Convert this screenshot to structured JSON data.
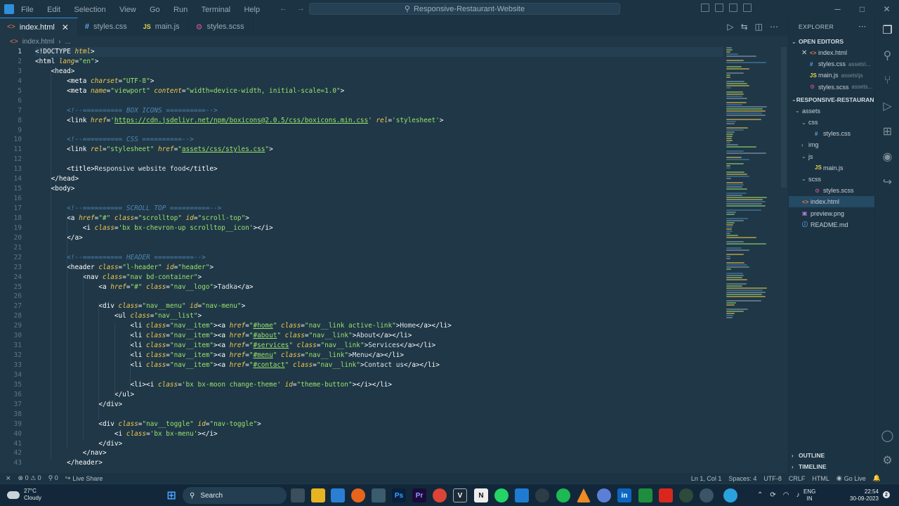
{
  "titlebar": {
    "menu": [
      "File",
      "Edit",
      "Selection",
      "View",
      "Go",
      "Run",
      "Terminal",
      "Help"
    ],
    "search": "Responsive-Restaurant-Website",
    "window_controls": [
      "─",
      "□",
      "✕"
    ]
  },
  "tabs": [
    {
      "icon": "<>",
      "label": "index.html",
      "active": true
    },
    {
      "icon": "#",
      "label": "styles.css"
    },
    {
      "icon": "JS",
      "label": "main.js"
    },
    {
      "icon": "⚙",
      "label": "styles.scss"
    }
  ],
  "breadcrumb": {
    "file": "index.html",
    "rest": "..."
  },
  "editor": {
    "line_numbers": [
      "1",
      "2",
      "3",
      "4",
      "5",
      "6",
      "7",
      "8",
      "9",
      "10",
      "11",
      "12",
      "13",
      "14",
      "15",
      "16",
      "17",
      "18",
      "19",
      "20",
      "21",
      "22",
      "23",
      "24",
      "25",
      "26",
      "27",
      "28",
      "29",
      "30",
      "31",
      "32",
      "33",
      "34",
      "35",
      "36",
      "37",
      "38",
      "39",
      "40",
      "41",
      "42",
      "43"
    ],
    "lines": [
      [
        [
          "tag",
          "<!DOCTYPE "
        ],
        [
          "attr",
          "html"
        ],
        [
          "tag",
          ">"
        ]
      ],
      [
        [
          "tag",
          "<html "
        ],
        [
          "attr",
          "lang"
        ],
        [
          "tag",
          "="
        ],
        [
          "str",
          "\"en\""
        ],
        [
          "tag",
          ">"
        ]
      ],
      [
        [
          "txt",
          "    "
        ],
        [
          "tag",
          "<head>"
        ]
      ],
      [
        [
          "txt",
          "        "
        ],
        [
          "tag",
          "<meta "
        ],
        [
          "attr",
          "charset"
        ],
        [
          "tag",
          "="
        ],
        [
          "str",
          "\"UTF-8\""
        ],
        [
          "tag",
          ">"
        ]
      ],
      [
        [
          "txt",
          "        "
        ],
        [
          "tag",
          "<meta "
        ],
        [
          "attr",
          "name"
        ],
        [
          "tag",
          "="
        ],
        [
          "str",
          "\"viewport\" "
        ],
        [
          "attr",
          "content"
        ],
        [
          "tag",
          "="
        ],
        [
          "str",
          "\"width=device-width, initial-scale=1.0\""
        ],
        [
          "tag",
          ">"
        ]
      ],
      [],
      [
        [
          "txt",
          "        "
        ],
        [
          "cmt",
          "<!--========== BOX ICONS ==========-->"
        ]
      ],
      [
        [
          "txt",
          "        "
        ],
        [
          "tag",
          "<link "
        ],
        [
          "attr",
          "href"
        ],
        [
          "tag",
          "="
        ],
        [
          "str",
          "'"
        ],
        [
          "url",
          "https://cdn.jsdelivr.net/npm/boxicons@2.0.5/css/boxicons.min.css"
        ],
        [
          "str",
          "' "
        ],
        [
          "attr",
          "rel"
        ],
        [
          "tag",
          "="
        ],
        [
          "str",
          "'stylesheet'"
        ],
        [
          "tag",
          ">"
        ]
      ],
      [],
      [
        [
          "txt",
          "        "
        ],
        [
          "cmt",
          "<!--========== CSS ==========-->"
        ]
      ],
      [
        [
          "txt",
          "        "
        ],
        [
          "tag",
          "<link "
        ],
        [
          "attr",
          "rel"
        ],
        [
          "tag",
          "="
        ],
        [
          "str",
          "\"stylesheet\" "
        ],
        [
          "attr",
          "href"
        ],
        [
          "tag",
          "="
        ],
        [
          "str",
          "\""
        ],
        [
          "url",
          "assets/css/styles.css"
        ],
        [
          "str",
          "\""
        ],
        [
          "tag",
          ">"
        ]
      ],
      [],
      [
        [
          "txt",
          "        "
        ],
        [
          "tag",
          "<title>"
        ],
        [
          "txt",
          "Responsive website food"
        ],
        [
          "tag",
          "</title>"
        ]
      ],
      [
        [
          "txt",
          "    "
        ],
        [
          "tag",
          "</head>"
        ]
      ],
      [
        [
          "txt",
          "    "
        ],
        [
          "tag",
          "<body>"
        ]
      ],
      [],
      [
        [
          "txt",
          "        "
        ],
        [
          "cmt",
          "<!--========== SCROLL TOP ==========-->"
        ]
      ],
      [
        [
          "txt",
          "        "
        ],
        [
          "tag",
          "<a "
        ],
        [
          "attr",
          "href"
        ],
        [
          "tag",
          "="
        ],
        [
          "str",
          "\"#\" "
        ],
        [
          "attr",
          "class"
        ],
        [
          "tag",
          "="
        ],
        [
          "str",
          "\"scrolltop\" "
        ],
        [
          "attr",
          "id"
        ],
        [
          "tag",
          "="
        ],
        [
          "str",
          "\"scroll-top\""
        ],
        [
          "tag",
          ">"
        ]
      ],
      [
        [
          "txt",
          "            "
        ],
        [
          "tag",
          "<i "
        ],
        [
          "attr",
          "class"
        ],
        [
          "tag",
          "="
        ],
        [
          "str",
          "'bx bx-chevron-up scrolltop__icon'"
        ],
        [
          "tag",
          "></i>"
        ]
      ],
      [
        [
          "txt",
          "        "
        ],
        [
          "tag",
          "</a>"
        ]
      ],
      [],
      [
        [
          "txt",
          "        "
        ],
        [
          "cmt",
          "<!--========== HEADER ==========-->"
        ]
      ],
      [
        [
          "txt",
          "        "
        ],
        [
          "tag",
          "<header "
        ],
        [
          "attr",
          "class"
        ],
        [
          "tag",
          "="
        ],
        [
          "str",
          "\"l-header\" "
        ],
        [
          "attr",
          "id"
        ],
        [
          "tag",
          "="
        ],
        [
          "str",
          "\"header\""
        ],
        [
          "tag",
          ">"
        ]
      ],
      [
        [
          "txt",
          "            "
        ],
        [
          "tag",
          "<nav "
        ],
        [
          "attr",
          "class"
        ],
        [
          "tag",
          "="
        ],
        [
          "str",
          "\"nav bd-container\""
        ],
        [
          "tag",
          ">"
        ]
      ],
      [
        [
          "txt",
          "                "
        ],
        [
          "tag",
          "<a "
        ],
        [
          "attr",
          "href"
        ],
        [
          "tag",
          "="
        ],
        [
          "str",
          "\"#\" "
        ],
        [
          "attr",
          "class"
        ],
        [
          "tag",
          "="
        ],
        [
          "str",
          "\"nav__logo\""
        ],
        [
          "tag",
          ">"
        ],
        [
          "txt",
          "Tadka"
        ],
        [
          "tag",
          "</a>"
        ]
      ],
      [],
      [
        [
          "txt",
          "                "
        ],
        [
          "tag",
          "<div "
        ],
        [
          "attr",
          "class"
        ],
        [
          "tag",
          "="
        ],
        [
          "str",
          "\"nav__menu\" "
        ],
        [
          "attr",
          "id"
        ],
        [
          "tag",
          "="
        ],
        [
          "str",
          "\"nav-menu\""
        ],
        [
          "tag",
          ">"
        ]
      ],
      [
        [
          "txt",
          "                    "
        ],
        [
          "tag",
          "<ul "
        ],
        [
          "attr",
          "class"
        ],
        [
          "tag",
          "="
        ],
        [
          "str",
          "\"nav__list\""
        ],
        [
          "tag",
          ">"
        ]
      ],
      [
        [
          "txt",
          "                        "
        ],
        [
          "tag",
          "<li "
        ],
        [
          "attr",
          "class"
        ],
        [
          "tag",
          "="
        ],
        [
          "str",
          "\"nav__item\""
        ],
        [
          "tag",
          "><a "
        ],
        [
          "attr",
          "href"
        ],
        [
          "tag",
          "="
        ],
        [
          "str",
          "\""
        ],
        [
          "url",
          "#home"
        ],
        [
          "str",
          "\" "
        ],
        [
          "attr",
          "class"
        ],
        [
          "tag",
          "="
        ],
        [
          "str",
          "\"nav__link active-link\""
        ],
        [
          "tag",
          ">"
        ],
        [
          "txt",
          "Home"
        ],
        [
          "tag",
          "</a></li>"
        ]
      ],
      [
        [
          "txt",
          "                        "
        ],
        [
          "tag",
          "<li "
        ],
        [
          "attr",
          "class"
        ],
        [
          "tag",
          "="
        ],
        [
          "str",
          "\"nav__item\""
        ],
        [
          "tag",
          "><a "
        ],
        [
          "attr",
          "href"
        ],
        [
          "tag",
          "="
        ],
        [
          "str",
          "\""
        ],
        [
          "url",
          "#about"
        ],
        [
          "str",
          "\" "
        ],
        [
          "attr",
          "class"
        ],
        [
          "tag",
          "="
        ],
        [
          "str",
          "\"nav__link\""
        ],
        [
          "tag",
          ">"
        ],
        [
          "txt",
          "About"
        ],
        [
          "tag",
          "</a></li>"
        ]
      ],
      [
        [
          "txt",
          "                        "
        ],
        [
          "tag",
          "<li "
        ],
        [
          "attr",
          "class"
        ],
        [
          "tag",
          "="
        ],
        [
          "str",
          "\"nav__item\""
        ],
        [
          "tag",
          "><a "
        ],
        [
          "attr",
          "href"
        ],
        [
          "tag",
          "="
        ],
        [
          "str",
          "\""
        ],
        [
          "url",
          "#services"
        ],
        [
          "str",
          "\" "
        ],
        [
          "attr",
          "class"
        ],
        [
          "tag",
          "="
        ],
        [
          "str",
          "\"nav__link\""
        ],
        [
          "tag",
          ">"
        ],
        [
          "txt",
          "Services"
        ],
        [
          "tag",
          "</a></li>"
        ]
      ],
      [
        [
          "txt",
          "                        "
        ],
        [
          "tag",
          "<li "
        ],
        [
          "attr",
          "class"
        ],
        [
          "tag",
          "="
        ],
        [
          "str",
          "\"nav__item\""
        ],
        [
          "tag",
          "><a "
        ],
        [
          "attr",
          "href"
        ],
        [
          "tag",
          "="
        ],
        [
          "str",
          "\""
        ],
        [
          "url",
          "#menu"
        ],
        [
          "str",
          "\" "
        ],
        [
          "attr",
          "class"
        ],
        [
          "tag",
          "="
        ],
        [
          "str",
          "\"nav__link\""
        ],
        [
          "tag",
          ">"
        ],
        [
          "txt",
          "Menu"
        ],
        [
          "tag",
          "</a></li>"
        ]
      ],
      [
        [
          "txt",
          "                        "
        ],
        [
          "tag",
          "<li "
        ],
        [
          "attr",
          "class"
        ],
        [
          "tag",
          "="
        ],
        [
          "str",
          "\"nav__item\""
        ],
        [
          "tag",
          "><a "
        ],
        [
          "attr",
          "href"
        ],
        [
          "tag",
          "="
        ],
        [
          "str",
          "\""
        ],
        [
          "url",
          "#contact"
        ],
        [
          "str",
          "\" "
        ],
        [
          "attr",
          "class"
        ],
        [
          "tag",
          "="
        ],
        [
          "str",
          "\"nav__link\""
        ],
        [
          "tag",
          ">"
        ],
        [
          "txt",
          "Contact us"
        ],
        [
          "tag",
          "</a></li>"
        ]
      ],
      [],
      [
        [
          "txt",
          "                        "
        ],
        [
          "tag",
          "<li><i "
        ],
        [
          "attr",
          "class"
        ],
        [
          "tag",
          "="
        ],
        [
          "str",
          "'bx bx-moon change-theme' "
        ],
        [
          "attr",
          "id"
        ],
        [
          "tag",
          "="
        ],
        [
          "str",
          "\"theme-button\""
        ],
        [
          "tag",
          "></i></li>"
        ]
      ],
      [
        [
          "txt",
          "                    "
        ],
        [
          "tag",
          "</ul>"
        ]
      ],
      [
        [
          "txt",
          "                "
        ],
        [
          "tag",
          "</div>"
        ]
      ],
      [],
      [
        [
          "txt",
          "                "
        ],
        [
          "tag",
          "<div "
        ],
        [
          "attr",
          "class"
        ],
        [
          "tag",
          "="
        ],
        [
          "str",
          "\"nav__toggle\" "
        ],
        [
          "attr",
          "id"
        ],
        [
          "tag",
          "="
        ],
        [
          "str",
          "\"nav-toggle\""
        ],
        [
          "tag",
          ">"
        ]
      ],
      [
        [
          "txt",
          "                    "
        ],
        [
          "tag",
          "<i "
        ],
        [
          "attr",
          "class"
        ],
        [
          "tag",
          "="
        ],
        [
          "str",
          "'bx bx-menu'"
        ],
        [
          "tag",
          "></i>"
        ]
      ],
      [
        [
          "txt",
          "                "
        ],
        [
          "tag",
          "</div>"
        ]
      ],
      [
        [
          "txt",
          "            "
        ],
        [
          "tag",
          "</nav>"
        ]
      ],
      [
        [
          "txt",
          "        "
        ],
        [
          "tag",
          "</header>"
        ]
      ]
    ]
  },
  "explorer": {
    "title": "EXPLORER",
    "open_editors_label": "OPEN EDITORS",
    "open_editors": [
      {
        "icon": "<>",
        "name": "index.html",
        "hint": "",
        "close": true
      },
      {
        "icon": "#",
        "name": "styles.css",
        "hint": "assets\\..."
      },
      {
        "icon": "JS",
        "name": "main.js",
        "hint": "assets\\js"
      },
      {
        "icon": "⚙",
        "name": "styles.scss",
        "hint": "assets..."
      }
    ],
    "project_label": "RESPONSIVE-RESTAURAN...",
    "tree": [
      {
        "chev": "⌄",
        "icon": "",
        "name": "assets",
        "indent": 1
      },
      {
        "chev": "⌄",
        "icon": "",
        "name": "css",
        "indent": 2
      },
      {
        "chev": "",
        "icon": "#",
        "name": "styles.css",
        "indent": 3
      },
      {
        "chev": "›",
        "icon": "",
        "name": "img",
        "indent": 2
      },
      {
        "chev": "⌄",
        "icon": "",
        "name": "js",
        "indent": 2
      },
      {
        "chev": "",
        "icon": "JS",
        "name": "main.js",
        "indent": 3
      },
      {
        "chev": "⌄",
        "icon": "",
        "name": "scss",
        "indent": 2
      },
      {
        "chev": "",
        "icon": "⚙",
        "name": "styles.scss",
        "indent": 3
      },
      {
        "chev": "",
        "icon": "<>",
        "name": "index.html",
        "indent": 1,
        "selected": true
      },
      {
        "chev": "",
        "icon": "▣",
        "name": "preview.png",
        "indent": 1
      },
      {
        "chev": "",
        "icon": "ⓘ",
        "name": "README.md",
        "indent": 1
      }
    ],
    "outline": "OUTLINE",
    "timeline": "TIMELINE"
  },
  "statusbar": {
    "left": [
      "⨯",
      "⊗ 0 ⚠ 0",
      "⚲ 0",
      "Live Share"
    ],
    "right": [
      "Ln 1, Col 1",
      "Spaces: 4",
      "UTF-8",
      "CRLF",
      "HTML",
      "Go Live"
    ]
  },
  "taskbar": {
    "temp": "27°C",
    "weather": "Cloudy",
    "search": "Search",
    "lang1": "ENG",
    "lang2": "IN",
    "time": "22:54",
    "date": "30-09-2023",
    "notification_count": "2"
  },
  "colors": {
    "accent": "#2f8fdd",
    "bg": "#1f3747",
    "panel": "#1c3343"
  }
}
